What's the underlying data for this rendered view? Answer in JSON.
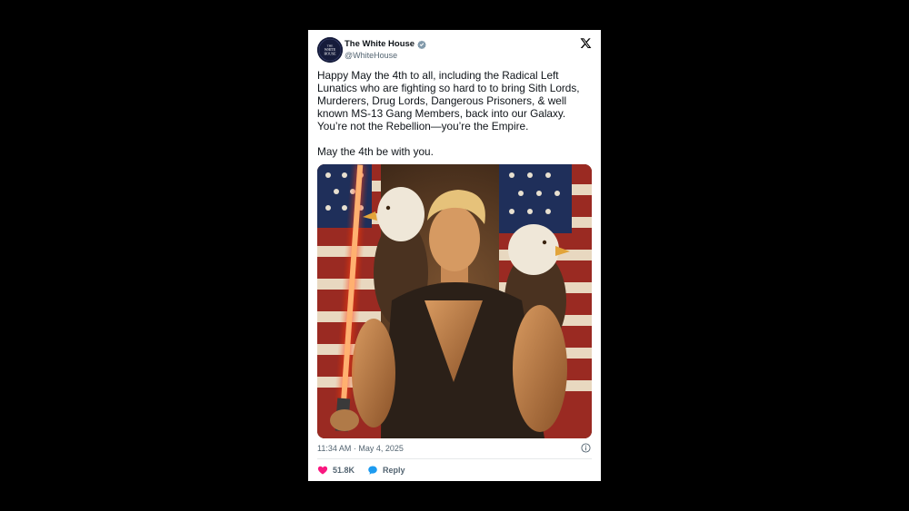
{
  "tweet": {
    "author_name": "The White House",
    "handle": "@WhiteHouse",
    "avatar_text": [
      "THE",
      "WHITE",
      "HOUSE"
    ],
    "paragraphs": [
      "Happy May the 4th to all, including the Radical Left Lunatics who are fighting so hard to to bring Sith Lords, Murderers, Drug Lords, Dangerous Prisoners, & well known MS-13 Gang Members, back into our Galaxy. You’re not the Rebellion—you’re the Empire.",
      "May the 4th be with you."
    ],
    "timestamp": "11:34 AM · May 4, 2025",
    "likes": "51.8K",
    "reply_label": "Reply"
  },
  "icons": {
    "verified": "verified-badge-icon",
    "logo": "x-logo-icon",
    "info": "info-icon",
    "like": "heart-icon",
    "reply": "reply-bubble-icon"
  },
  "colors": {
    "background": "#000000",
    "card": "#ffffff",
    "text": "#0f1419",
    "secondary": "#536471",
    "like": "#f91880",
    "reply": "#1d9bf0",
    "verified": "#829aab",
    "lightsaber": "#ff5a1f"
  }
}
